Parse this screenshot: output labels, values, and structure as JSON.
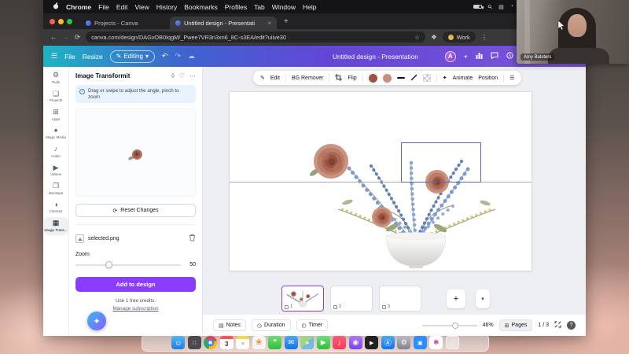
{
  "menu_bar": {
    "items": [
      "Chrome",
      "File",
      "Edit",
      "View",
      "History",
      "Bookmarks",
      "Profiles",
      "Tab",
      "Window",
      "Help"
    ],
    "status_icons": [
      "battery-icon",
      "search-icon",
      "control-center-icon",
      "clock-icon"
    ]
  },
  "browser": {
    "tab1": "Projects - Canva",
    "tab2": "Untitled design - Presentati",
    "url": "canva.com/design/DAGvOB0IqgM/_Pwee7VR3n3xn6_8C-s3EA/edit?uiive30",
    "profile": "Work"
  },
  "canva": {
    "header": {
      "file": "File",
      "resize": "Resize",
      "editing": "Editing",
      "title": "Untitled design - Presentation",
      "avatar": "A"
    },
    "rail": [
      {
        "label": "Tools",
        "glyph": "⚙"
      },
      {
        "label": "Projects",
        "glyph": "❏"
      },
      {
        "label": "Apps",
        "glyph": "⊞"
      },
      {
        "label": "Magic Media",
        "glyph": "✦"
      },
      {
        "label": "Audio",
        "glyph": "♪"
      },
      {
        "label": "Videos",
        "glyph": "▶"
      },
      {
        "label": "Mockups",
        "glyph": "❐"
      },
      {
        "label": "Colorize",
        "glyph": "◑"
      },
      {
        "label": "Image Trans...",
        "glyph": "▦"
      }
    ],
    "panel": {
      "title": "Image Transformit",
      "hint": "Drag or swipe to adjust the angle, pinch to zoom",
      "reset": "Reset Changes",
      "filename": "selected.png",
      "zoom_label": "Zoom",
      "zoom_value": "50",
      "add_button": "Add to design",
      "credits": "Use 1 free credits.",
      "manage": "Manage subscription"
    },
    "toolbar": {
      "edit": "Edit",
      "bg_remover": "BG Remover",
      "flip": "Flip",
      "animate": "Animate",
      "position": "Position",
      "colors": [
        "#9a5242",
        "#c68e7e"
      ]
    },
    "pages": [
      {
        "num": "1"
      },
      {
        "num": "2"
      },
      {
        "num": "3"
      }
    ],
    "footer": {
      "notes": "Notes",
      "duration": "Duration",
      "timer": "Timer",
      "zoom_percent": "46%",
      "pages": "Pages",
      "indicator": "1 / 3"
    }
  },
  "video_call": {
    "name": "Amy Balsters"
  },
  "dock": {
    "icons": [
      {
        "name": "finder",
        "glyph": "☺",
        "cls": "dk-finder"
      },
      {
        "name": "launchpad",
        "glyph": "∷",
        "cls": "dk-dark"
      },
      {
        "name": "chrome",
        "glyph": "",
        "cls": "dk-chrome"
      },
      {
        "name": "calendar",
        "glyph": "3",
        "cls": "dk-cal"
      },
      {
        "name": "notes",
        "glyph": "≡",
        "cls": "dk-notes"
      },
      {
        "name": "photos",
        "glyph": "❀",
        "cls": "dk-photos"
      },
      {
        "name": "messages",
        "glyph": "❞",
        "cls": "dk-green"
      },
      {
        "name": "mail",
        "glyph": "✉",
        "cls": "dk-blue"
      },
      {
        "name": "maps",
        "glyph": "➤",
        "cls": "dk-maps"
      },
      {
        "name": "facetime",
        "glyph": "▶",
        "cls": "dk-green"
      },
      {
        "name": "music",
        "glyph": "♪",
        "cls": "dk-music"
      },
      {
        "name": "podcasts",
        "glyph": "◉",
        "cls": "dk-purple"
      },
      {
        "name": "tv",
        "glyph": "▶",
        "cls": "dk-black"
      },
      {
        "name": "app-store",
        "glyph": "Ⓐ",
        "cls": "dk-blue"
      },
      {
        "name": "settings",
        "glyph": "⚙",
        "cls": "dk-gray"
      },
      {
        "name": "zoom",
        "glyph": "▣",
        "cls": "dk-zoomblue"
      },
      {
        "name": "slack",
        "glyph": "✱",
        "cls": "dk-white"
      },
      {
        "name": "trash",
        "glyph": "▯",
        "cls": "dk-trash"
      }
    ]
  }
}
